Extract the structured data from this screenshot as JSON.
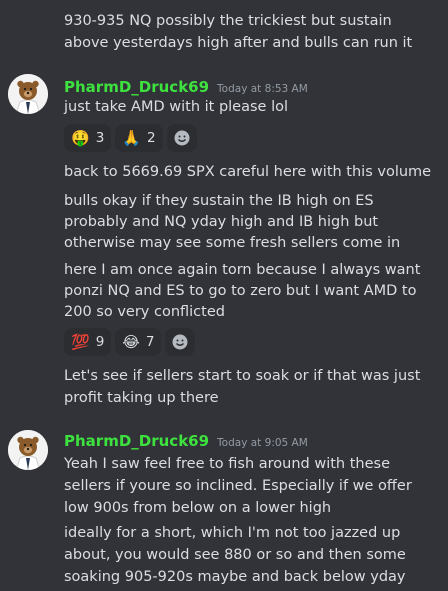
{
  "messages": [
    {
      "lines": [
        "930-935 NQ possibly the trickiest but sustain",
        "above yesterdays high after and bulls can run it"
      ]
    },
    {
      "author": "PharmD_Druck69",
      "timestamp": "Today at 8:53 AM",
      "line1": "just take AMD with it please lol",
      "reactions1": [
        {
          "emoji": "🤑",
          "count": "3"
        },
        {
          "emoji": "🙏",
          "count": "2"
        }
      ],
      "line2": "back to 5669.69 SPX careful here with this volume",
      "para3": [
        "bulls okay if they sustain the IB high on ES",
        "probably and NQ yday high and IB high but",
        "otherwise may see some fresh sellers come in"
      ],
      "para4": [
        "here I am once again torn because I always want",
        "ponzi NQ and ES to go to zero but I want AMD to",
        "200 so very conflicted"
      ],
      "reactions2": [
        {
          "emoji": "💯",
          "count": "9"
        },
        {
          "emoji": "😂",
          "count": "7"
        }
      ],
      "para5": [
        "Let's see if sellers start to soak or if that was just",
        "profit taking up there"
      ]
    },
    {
      "author": "PharmD_Druck69",
      "timestamp": "Today at 9:05 AM",
      "para1": [
        "Yeah I saw feel free to fish around with these",
        "sellers if youre so inclined. Especially if we offer",
        "low 900s from below on a lower high"
      ],
      "para2": [
        "ideally for a short, which I'm not too jazzed up",
        "about, you would see 880 or so and then some",
        "soaking 905-920s maybe and back below yday"
      ]
    }
  ],
  "colors": {
    "background": "#313338",
    "text": "#dbdee1",
    "author": "#3ee23e",
    "timestamp": "#949ba4",
    "reaction_bg": "#2b2d31"
  },
  "icons": {
    "add_reaction": "smiley-add-reaction-icon",
    "avatar": "bear-in-lab-coat-avatar"
  }
}
